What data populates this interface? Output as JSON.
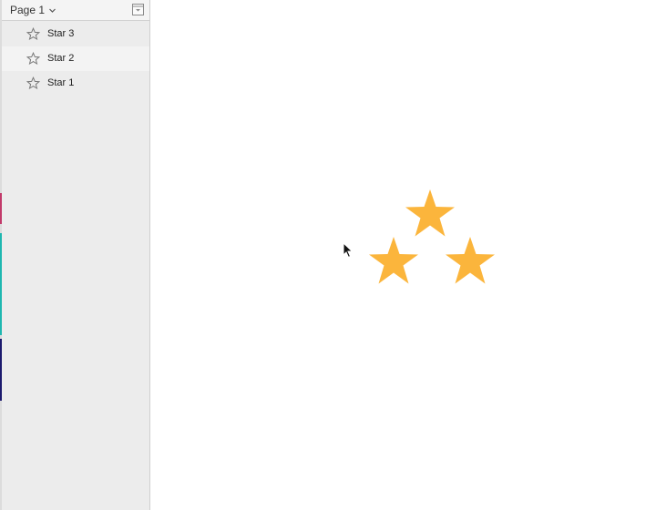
{
  "page_selector": {
    "label": "Page 1",
    "icon": "chevron-down-icon"
  },
  "sidebar": {
    "collapse_icon": "collapse-panel-icon",
    "layers": [
      {
        "label": "Star 3",
        "icon": "star-outline-icon"
      },
      {
        "label": "Star 2",
        "icon": "star-outline-icon"
      },
      {
        "label": "Star 1",
        "icon": "star-outline-icon"
      }
    ]
  },
  "canvas": {
    "star_fill": "#fbb53c",
    "stars": [
      "Star 3",
      "Star 2",
      "Star 1"
    ]
  },
  "colors": {
    "sidebar_bg": "#ececec",
    "header_bg": "#f4f4f4",
    "edge_strip": [
      "#c23a6a",
      "#1fb7b0",
      "#1c1a6e"
    ]
  }
}
